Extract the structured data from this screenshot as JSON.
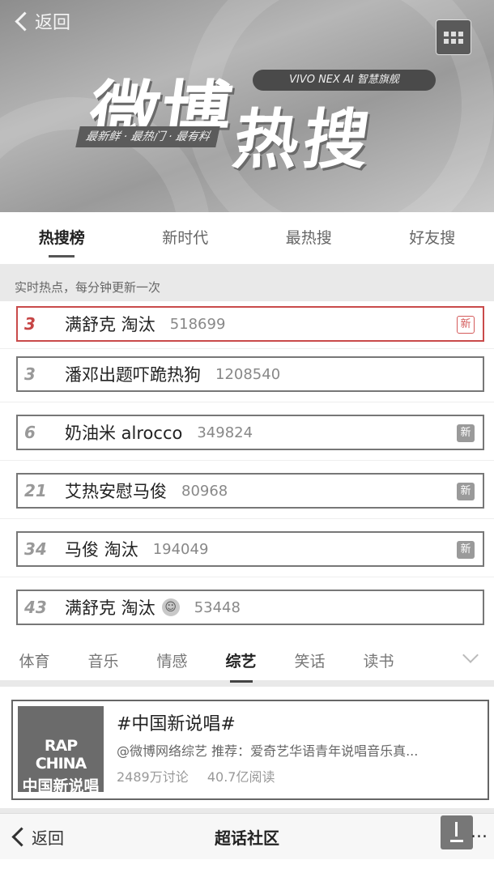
{
  "header": {
    "back_label": "返回",
    "logo_line1": "微博",
    "logo_line2": "热搜",
    "sponsor": "VIVO NEX AI 智慧旗舰",
    "tagline": "最新鲜 · 最热门 · 最有料"
  },
  "tabs": [
    {
      "label": "热搜榜",
      "active": true
    },
    {
      "label": "新时代",
      "active": false
    },
    {
      "label": "最热搜",
      "active": false
    },
    {
      "label": "好友搜",
      "active": false
    }
  ],
  "subtitle": "实时热点，每分钟更新一次",
  "list": [
    {
      "rank": "3",
      "title": "满舒克 淘汰",
      "count": "518699",
      "badge": "新",
      "highlight": true
    },
    {
      "rank": "3",
      "title": "潘邓出题吓跪热狗",
      "count": "1208540",
      "badge": "",
      "highlight": false
    },
    {
      "rank": "6",
      "title": "奶油米 alrocco",
      "count": "349824",
      "badge": "新",
      "highlight": false
    },
    {
      "rank": "21",
      "title": "艾热安慰马俊",
      "count": "80968",
      "badge": "新",
      "highlight": false
    },
    {
      "rank": "34",
      "title": "马俊 淘汰",
      "count": "194049",
      "badge": "新",
      "highlight": false
    },
    {
      "rank": "43",
      "title": "满舒克 淘汰",
      "count": "53448",
      "badge": "",
      "highlight": false
    }
  ],
  "categories": [
    {
      "label": "体育",
      "active": false
    },
    {
      "label": "音乐",
      "active": false
    },
    {
      "label": "情感",
      "active": false
    },
    {
      "label": "综艺",
      "active": true
    },
    {
      "label": "笑话",
      "active": false
    },
    {
      "label": "读书",
      "active": false
    }
  ],
  "topic": {
    "thumb_line1": "RAP CHINA",
    "thumb_line2": "中国新说唱",
    "title": "#中国新说唱#",
    "desc": "@微博网络综艺 推荐：爱奇艺华语青年说唱音乐真...",
    "discussions": "2489万讨论",
    "reads": "40.7亿阅读"
  },
  "bottom_bar": {
    "back_label": "返回",
    "title": "超话社区",
    "more": "..."
  }
}
